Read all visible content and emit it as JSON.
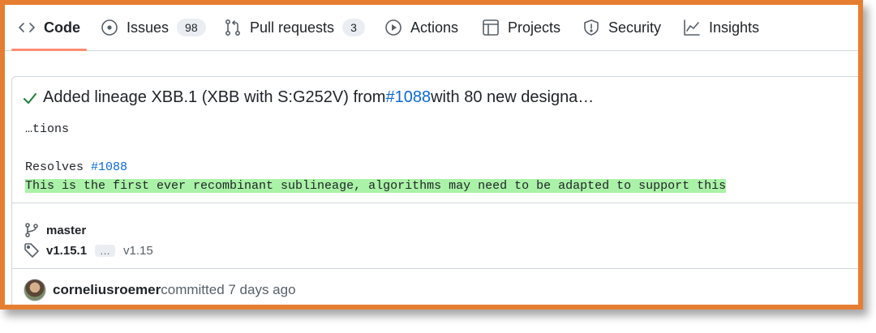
{
  "tabs": [
    {
      "label": "Code",
      "icon": "code-icon",
      "counter": null,
      "active": true
    },
    {
      "label": "Issues",
      "icon": "issue-opened-icon",
      "counter": "98"
    },
    {
      "label": "Pull requests",
      "icon": "git-pull-request-icon",
      "counter": "3"
    },
    {
      "label": "Actions",
      "icon": "play-icon",
      "counter": null
    },
    {
      "label": "Projects",
      "icon": "table-icon",
      "counter": null
    },
    {
      "label": "Security",
      "icon": "shield-icon",
      "counter": null
    },
    {
      "label": "Insights",
      "icon": "graph-icon",
      "counter": null
    }
  ],
  "commit": {
    "title_prefix": "Added lineage XBB.1 (XBB with S:G252V) from ",
    "title_link": "#1088",
    "title_suffix": " with 80 new designa…",
    "body_continuation": "…tions",
    "resolves_label": "Resolves ",
    "resolves_link": "#1088",
    "highlighted_line": "This is the first ever recombinant sublineage, algorithms may need to be adapted to support this",
    "branch": "master",
    "tag_newest": "v1.15.1",
    "tag_ellipsis": "…",
    "tag_oldest": "v1.15",
    "author": "corneliusroemer",
    "committed_text": " committed 7 days ago"
  },
  "colors": {
    "frame": "#e67e32",
    "link": "#0969da",
    "success": "#1a7f37",
    "highlight": "#aaf2a7"
  }
}
